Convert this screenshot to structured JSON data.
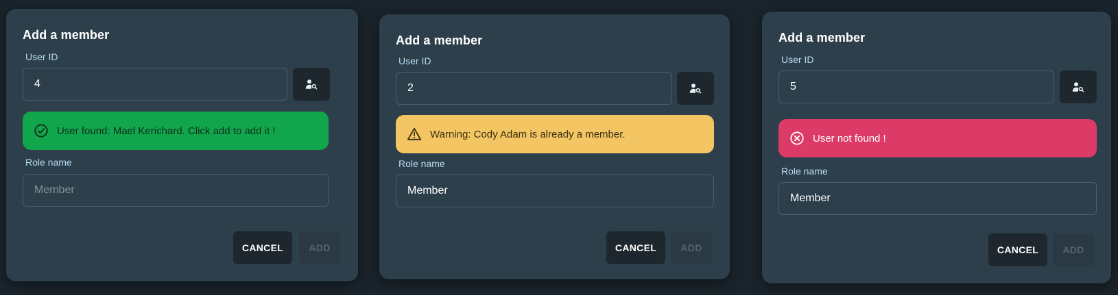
{
  "dialogs": [
    {
      "title": "Add a member",
      "user_id_label": "User ID",
      "user_id_value": "4",
      "alert": {
        "type": "success",
        "message": "User found: Mael Kerichard. Click add to add it !",
        "icon": "check-circle-icon"
      },
      "role_label": "Role name",
      "role_value": "",
      "role_placeholder": "Member",
      "cancel_label": "CANCEL",
      "add_label": "ADD"
    },
    {
      "title": "Add a member",
      "user_id_label": "User ID",
      "user_id_value": "2",
      "alert": {
        "type": "warning",
        "message": "Warning: Cody Adam is already a member.",
        "icon": "warning-triangle-icon"
      },
      "role_label": "Role name",
      "role_value": "Member",
      "role_placeholder": "",
      "cancel_label": "CANCEL",
      "add_label": "ADD"
    },
    {
      "title": "Add a member",
      "user_id_label": "User ID",
      "user_id_value": "5",
      "alert": {
        "type": "error",
        "message": "User not found !",
        "icon": "x-circle-icon"
      },
      "role_label": "Role name",
      "role_value": "Member",
      "role_placeholder": "",
      "cancel_label": "CANCEL",
      "add_label": "ADD"
    }
  ],
  "colors": {
    "page_background": "#1a242c",
    "dialog_background": "#2d3f4b",
    "label": "#b8dcf2",
    "success": "#12a64c",
    "warning": "#f4c663",
    "error": "#dc3b68",
    "dark_button": "#1e272d"
  },
  "icons": {
    "search_button": "user-search-icon"
  }
}
